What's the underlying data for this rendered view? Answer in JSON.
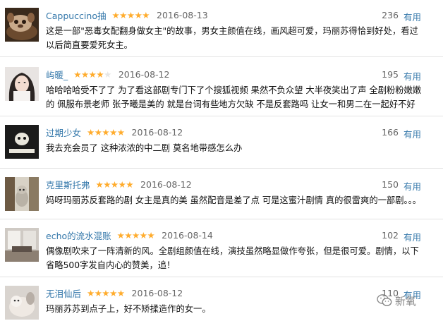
{
  "reviews": [
    {
      "user": "Cappuccino抽",
      "stars": 5,
      "stars_filled": "★★★★★",
      "stars_empty": "",
      "date": "2016-08-13",
      "votes": "236",
      "useful": "有用",
      "text": "这是一部\"恶毒女配翻身做女主\"的故事，男女主颜值在线，画风超可爱，玛丽苏得恰到好处，看过以后简直要爱死女主。"
    },
    {
      "user": "屿暖_",
      "stars": 4,
      "stars_filled": "★★★★",
      "stars_empty": "★",
      "date": "2016-08-12",
      "votes": "195",
      "useful": "有用",
      "text": "哈哈哈哈受不了了 为了看这部剧专门下了个搜狐视频 果然不负众望 大半夜笑出了声 全剧粉粉嫩嫩的 佩服布景老师 张予曦是美的 就是台词有些地方欠缺 不是反套路吗 让女一和男二在一起好不好"
    },
    {
      "user": "过期少女",
      "stars": 5,
      "stars_filled": "★★★★★",
      "stars_empty": "",
      "date": "2016-08-12",
      "votes": "166",
      "useful": "有用",
      "text": "我去充会员了 这种浓浓的中二剧 莫名地带感怎么办"
    },
    {
      "user": "克里斯托弗",
      "stars": 5,
      "stars_filled": "★★★★★",
      "stars_empty": "",
      "date": "2016-08-12",
      "votes": "150",
      "useful": "有用",
      "text": "妈呀玛丽苏反套路的剧 女主是真的美 虽然配音是差了点 可是这蜜汁剧情 真的很雷爽的一部剧。。。"
    },
    {
      "user": "echo的流水混账",
      "stars": 5,
      "stars_filled": "★★★★★",
      "stars_empty": "",
      "date": "2016-08-14",
      "votes": "102",
      "useful": "有用",
      "text": "偶像剧吹来了一阵清新的风。全剧组颜值在线，演技虽然略显做作夸张，但是很可爱。剧情，以下省略500字发自内心的赞美，追！"
    },
    {
      "user": "无泪仙后",
      "stars": 5,
      "stars_filled": "★★★★★",
      "stars_empty": "",
      "date": "2016-08-12",
      "votes": "110",
      "useful": "有用",
      "text": "玛丽苏苏到点子上，好不矫揉造作的女一。"
    }
  ],
  "watermark": {
    "text": "新氧",
    "icon": "wechat-icon"
  },
  "colors": {
    "link": "#3377aa",
    "star": "#ffac2d",
    "divider": "#e3e3e3"
  }
}
